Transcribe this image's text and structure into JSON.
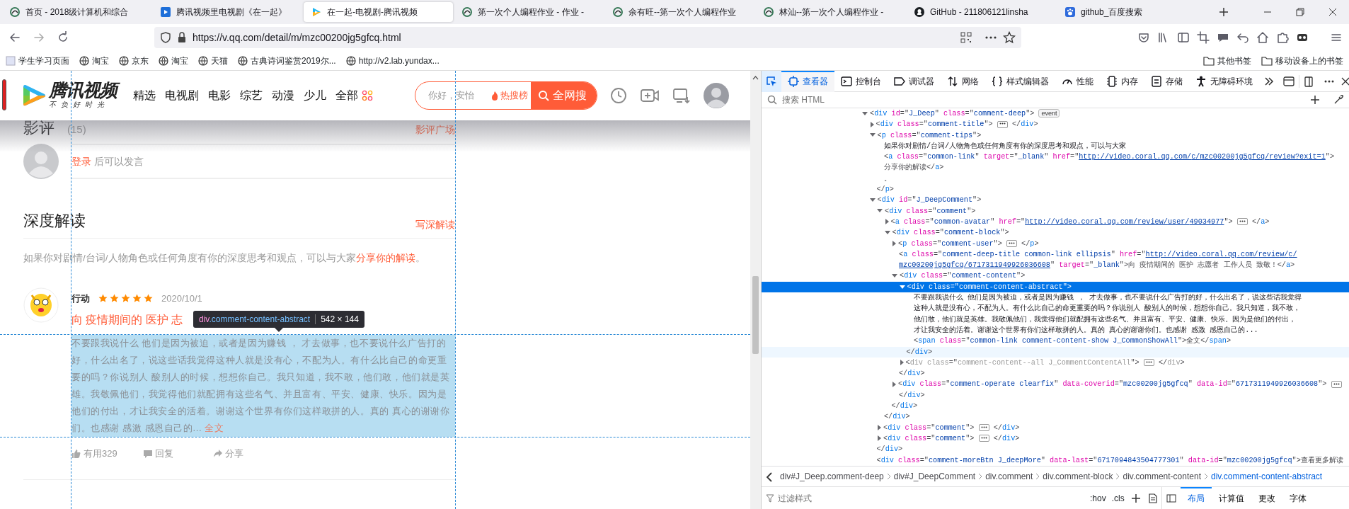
{
  "browser": {
    "tabs": [
      {
        "title": "首页 - 2018级计算机和综合",
        "selected": false
      },
      {
        "title": "腾讯视频里电视剧《在一起》",
        "selected": false
      },
      {
        "title": "在一起-电视剧-腾讯视频",
        "selected": true
      },
      {
        "title": "第一次个人编程作业 - 作业 -",
        "selected": false
      },
      {
        "title": "余有旺--第一次个人编程作业",
        "selected": false
      },
      {
        "title": "林汕--第一次个人编程作业 -",
        "selected": false
      },
      {
        "title": "GitHub - 211806121linsha",
        "selected": false
      },
      {
        "title": "github_百度搜索",
        "selected": false
      }
    ],
    "url": "https://v.qq.com/detail/m/mzc00200jg5gfcq.html",
    "bookmarks": [
      "学生学习页面",
      "淘宝",
      "京东",
      "淘宝",
      "天猫",
      "古典诗词鉴赏2019尔...",
      "http://v2.lab.yundax..."
    ],
    "bookmark_folders": [
      "其他书签",
      "移动设备上的书签"
    ]
  },
  "page": {
    "logo": "腾讯视频",
    "slogan": "不负好时光",
    "nav": [
      "精选",
      "电视剧",
      "电影",
      "综艺",
      "动漫",
      "少儿",
      "全部"
    ],
    "search": {
      "placeholder": "你好，安怡",
      "hot": "热搜榜",
      "button": "全网搜"
    },
    "reviews": {
      "title": "影评",
      "count": "(15)",
      "link": "影评广场",
      "login_link": "登录",
      "login_text": " 后可以发言"
    },
    "deep": {
      "title": "深度解读",
      "write_link": "写深解读",
      "tips": "如果你对剧情/台词/人物角色或任何角度有你的深度思考和观点，可以与大家",
      "tips_link": "分享你的解读",
      "tips_end": "。"
    },
    "comment": {
      "user": "行动",
      "stars": 5,
      "date": "2020/10/1",
      "title": "向 疫情期间的 医护 志",
      "abstract": "不要跟我说什么 他们是因为被迫，或者是因为赚钱 ， 才去做事，也不要说什么广告打的好，什么出名了，说这些话我觉得这种人就是没有心，不配为人。有什么比自己的命更重要的吗？你说别人 酸别人的时候，想想你自己。我只知道，我不敢，他们敢，他们就是英雄。我敬佩他们，我觉得他们就配拥有这些名气、并且富有、平安、健康、快乐。因为是他们的付出，才让我安全的活着。谢谢这个世界有你们这样敢拼的人。真的 真心的谢谢你们。也感谢 感激 感恩自己的...",
      "show_all": "全文",
      "actions": [
        "有用329",
        "回复",
        "分享"
      ]
    },
    "tooltip": {
      "tag": "div",
      "selector": ".comment-content-abstract",
      "size": "542 × 144"
    }
  },
  "devtools": {
    "tools": [
      {
        "label": "查看器",
        "selected": true
      },
      {
        "label": "控制台",
        "selected": false
      },
      {
        "label": "调试器",
        "selected": false
      },
      {
        "label": "网络",
        "selected": false
      },
      {
        "label": "样式编辑器",
        "selected": false
      },
      {
        "label": "性能",
        "selected": false
      },
      {
        "label": "内存",
        "selected": false
      },
      {
        "label": "存储",
        "selected": false
      },
      {
        "label": "无障碍环境",
        "selected": false
      }
    ],
    "search_placeholder": "搜索 HTML",
    "tree": [
      {
        "kind": "element",
        "open": "<div id=\"J_Deep\" class=\"comment-deep\">",
        "badge": "event",
        "expanded": true,
        "selected": false,
        "children": [
          {
            "kind": "element",
            "open": "<div class=\"comment-title\">",
            "expanded": false,
            "selected": false,
            "close": "</div>"
          },
          {
            "kind": "element",
            "open": "<p class=\"comment-tips\">",
            "expanded": true,
            "selected": false,
            "children": [
              {
                "kind": "text",
                "lines": [
                  "如果你对剧情/台词/人物角色或任何角度有你的深度思考和观点，可以与大家"
                ]
              },
              {
                "kind": "element",
                "open": "<a class=\"common-link\" target=\"_blank\" href=\"http://video.coral.qq.com/c/mzc00200jg5gfcq/review?exit=1\">",
                "text": "分享你的解读",
                "close": "</a>",
                "selected": false
              },
              {
                "kind": "text",
                "lines": [
                  "。"
                ]
              }
            ]
          },
          {
            "kind": "close",
            "markup": "</p>",
            "selected": false
          },
          {
            "kind": "element",
            "open": "<div id=\"J_DeepComment\">",
            "expanded": true,
            "selected": false,
            "children": [
              {
                "kind": "element",
                "open": "<div class=\"comment\">",
                "expanded": true,
                "selected": false,
                "children": [
                  {
                    "kind": "element",
                    "open": "<a class=\"common-avatar\" href=\"http://video.coral.qq.com/review/user/49034977\">",
                    "expanded": false,
                    "selected": false,
                    "close": "</a>"
                  },
                  {
                    "kind": "element",
                    "open": "<div class=\"comment-block\">",
                    "expanded": true,
                    "selected": false,
                    "children": [
                      {
                        "kind": "element",
                        "open": "<p class=\"comment-user\">",
                        "expanded": false,
                        "selected": false,
                        "close": "</p>"
                      },
                      {
                        "kind": "element",
                        "open": "<a class=\"comment-deep-title common-link ellipsis\" href=\"http://video.coral.qq.com/review/c/mzc00200jg5gfcq/6717311949926036608\" target=\"_blank\">",
                        "text": "向 疫情期间的 医护 志愿者 工作人员 致敬！",
                        "close": "</a>",
                        "selected": false
                      },
                      {
                        "kind": "element",
                        "open": "<div class=\"comment-content\">",
                        "expanded": true,
                        "selected": false,
                        "children": [
                          {
                            "kind": "element",
                            "open": "<div class=\"comment-content-abstract\">",
                            "expanded": true,
                            "selected": true,
                            "children": [
                              {
                                "kind": "text",
                                "lines": [
                                  "不要跟我说什么 他们是因为被迫，或者是因为赚钱 ， 才去做事，也不要说什么广告打的好，什么出名了，说这些话我觉得",
                                  "这种人就是没有心，不配为人。有什么比自己的命更重要的吗？你说别人 酸别人的时候，想想你自己。我只知道，我不敢，",
                                  "他们敢，他们就是英雄。我敬佩他们，我觉得他们就配拥有这些名气、并且富有、平安、健康、快乐。因为是他们的付出，",
                                  "才让我安全的活着。谢谢这个世界有你们这样敢拼的人。真的 真心的谢谢你们。也感谢 感激 感恩自己的..."
                                ]
                              },
                              {
                                "kind": "element",
                                "open": "<span class=\"common-link comment-content-show J_CommonShowAll\">",
                                "text": "全文",
                                "close": "</span>",
                                "selected": false
                              }
                            ]
                          },
                          {
                            "kind": "close",
                            "markup": "</div>",
                            "selected": true
                          },
                          {
                            "kind": "element",
                            "open": "<div class=\"comment-content--all J_CommentContentAll\">",
                            "expanded": false,
                            "hidden": true,
                            "selected": false,
                            "close": "</div>"
                          }
                        ]
                      },
                      {
                        "kind": "close",
                        "markup": "</div>",
                        "selected": false
                      },
                      {
                        "kind": "element",
                        "open": "<div class=\"comment-operate clearfix\" data-coverid=\"mzc00200jg5gfcq\" data-id=\"6717311949926036608\">",
                        "expanded": false,
                        "selected": false
                      },
                      {
                        "kind": "close",
                        "markup": "</div>",
                        "selected": false
                      }
                    ]
                  },
                  {
                    "kind": "close",
                    "markup": "</div>",
                    "selected": false
                  }
                ]
              },
              {
                "kind": "close",
                "markup": "</div>",
                "selected": false
              },
              {
                "kind": "element",
                "open": "<div class=\"comment\">",
                "expanded": false,
                "selected": false,
                "close": "</div>"
              },
              {
                "kind": "element",
                "open": "<div class=\"comment\">",
                "expanded": false,
                "selected": false,
                "close": "</div>"
              }
            ]
          },
          {
            "kind": "close",
            "markup": "</div>",
            "selected": false
          },
          {
            "kind": "element",
            "open": "<div class=\"comment-moreBtn J_deepMore\" data-last=\"6717094843504777301\" data-id=\"mzc00200jg5gfcq\">",
            "text": "查看更多解读",
            "selected": false
          }
        ]
      }
    ],
    "breadcrumbs": [
      {
        "label": "div#J_Deep.comment-deep",
        "selected": false
      },
      {
        "label": "div#J_DeepComment",
        "selected": false
      },
      {
        "label": "div.comment",
        "selected": false
      },
      {
        "label": "div.comment-block",
        "selected": false
      },
      {
        "label": "div.comment-content",
        "selected": false
      },
      {
        "label": "div.comment-content-abstract",
        "selected": true
      }
    ],
    "filter_placeholder": "过滤样式",
    "rule_buttons": [
      ":hov",
      ".cls"
    ],
    "side_tabs": [
      {
        "label": "布局",
        "selected": true
      },
      {
        "label": "计算值",
        "selected": false
      },
      {
        "label": "更改",
        "selected": false
      },
      {
        "label": "字体",
        "selected": false
      }
    ]
  }
}
